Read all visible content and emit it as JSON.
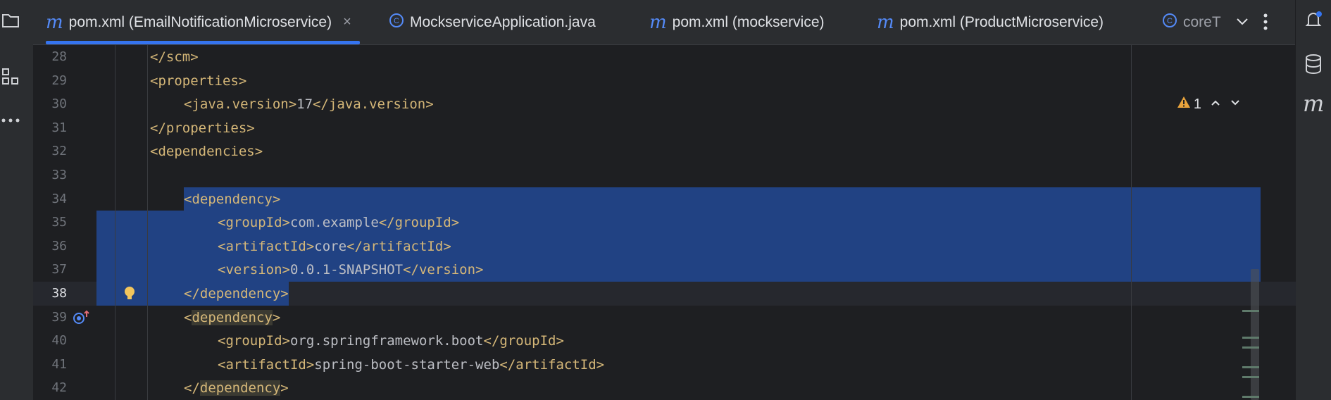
{
  "tabs": [
    {
      "label": "pom.xml (EmailNotificationMicroservice)",
      "icon": "m",
      "active": true
    },
    {
      "label": "MockserviceApplication.java",
      "icon": "java-class-icon",
      "active": false
    },
    {
      "label": "pom.xml (mockservice)",
      "icon": "m",
      "active": false
    },
    {
      "label": "pom.xml (ProductMicroservice)",
      "icon": "m",
      "active": false
    },
    {
      "label": "coreT",
      "icon": "c",
      "active": false
    }
  ],
  "tab_icon_m": "m",
  "tab_icon_c": "C",
  "close": "×",
  "inspection": {
    "count": "1"
  },
  "lines": [
    {
      "n": "28",
      "indent": 1,
      "parts": [
        {
          "t": "</scm>",
          "c": "tag"
        }
      ]
    },
    {
      "n": "29",
      "indent": 1,
      "parts": [
        {
          "t": "<properties>",
          "c": "tag"
        }
      ]
    },
    {
      "n": "30",
      "indent": 2,
      "parts": [
        {
          "t": "<java.version>",
          "c": "tag"
        },
        {
          "t": "17",
          "c": "txt"
        },
        {
          "t": "</java.version>",
          "c": "tag"
        }
      ]
    },
    {
      "n": "31",
      "indent": 1,
      "parts": [
        {
          "t": "</properties>",
          "c": "tag"
        }
      ]
    },
    {
      "n": "32",
      "indent": 1,
      "parts": [
        {
          "t": "<dependencies>",
          "c": "tag"
        }
      ]
    },
    {
      "n": "33",
      "indent": 0,
      "parts": []
    },
    {
      "n": "34",
      "indent": 2,
      "parts": [
        {
          "t": "<dependency>",
          "c": "tag"
        }
      ]
    },
    {
      "n": "35",
      "indent": 3,
      "parts": [
        {
          "t": "<groupId>",
          "c": "tag"
        },
        {
          "t": "com.example",
          "c": "txt"
        },
        {
          "t": "</groupId>",
          "c": "tag"
        }
      ]
    },
    {
      "n": "36",
      "indent": 3,
      "parts": [
        {
          "t": "<artifactId>",
          "c": "tag"
        },
        {
          "t": "core",
          "c": "txt"
        },
        {
          "t": "</artifactId>",
          "c": "tag"
        }
      ]
    },
    {
      "n": "37",
      "indent": 3,
      "parts": [
        {
          "t": "<version>",
          "c": "tag"
        },
        {
          "t": "0.0.1-SNAPSHOT",
          "c": "txt"
        },
        {
          "t": "</version>",
          "c": "tag"
        }
      ]
    },
    {
      "n": "38",
      "indent": 2,
      "parts": [
        {
          "t": "</dependency>",
          "c": "tag"
        }
      ]
    },
    {
      "n": "39",
      "indent": 2,
      "parts": [
        {
          "t": "<",
          "c": "tag"
        },
        {
          "t": "dependency",
          "c": "tag hl"
        },
        {
          "t": ">",
          "c": "tag"
        }
      ]
    },
    {
      "n": "40",
      "indent": 3,
      "parts": [
        {
          "t": "<groupId>",
          "c": "tag"
        },
        {
          "t": "org.springframework.boot",
          "c": "txt"
        },
        {
          "t": "</groupId>",
          "c": "tag"
        }
      ]
    },
    {
      "n": "41",
      "indent": 3,
      "parts": [
        {
          "t": "<artifactId>",
          "c": "tag"
        },
        {
          "t": "spring-boot-starter-web",
          "c": "txt"
        },
        {
          "t": "</artifactId>",
          "c": "tag"
        }
      ]
    },
    {
      "n": "42",
      "indent": 2,
      "parts": [
        {
          "t": "</",
          "c": "tag"
        },
        {
          "t": "dependency",
          "c": "tag hl"
        },
        {
          "t": ">",
          "c": "tag"
        }
      ]
    }
  ],
  "current_line": "38",
  "colors": {
    "accent": "#3574f0",
    "tag": "#d5b778",
    "text": "#bcbec4",
    "selection": "#214283"
  }
}
